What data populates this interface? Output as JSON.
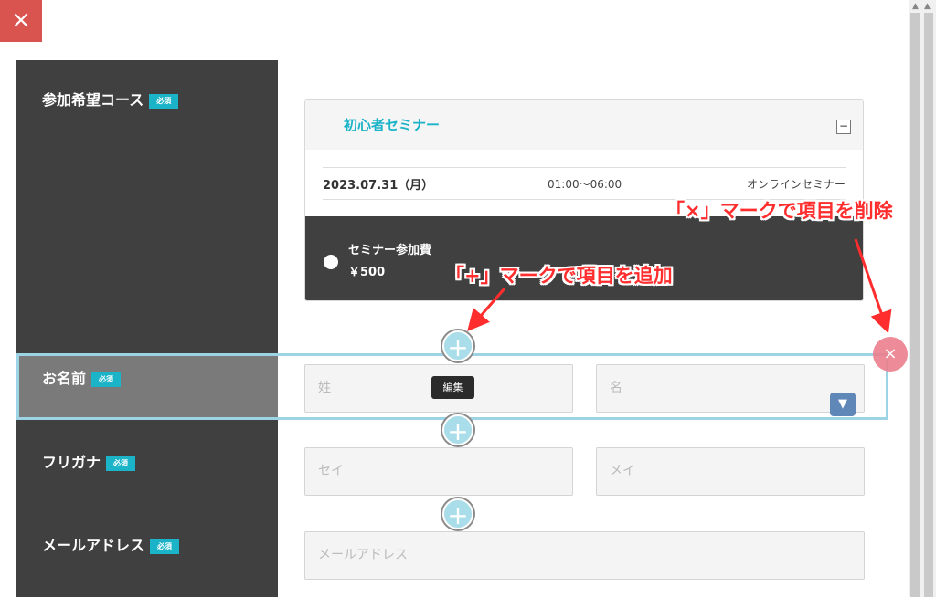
{
  "window": {
    "close_label": "×"
  },
  "form": {
    "fields": [
      {
        "label": "参加希望コース",
        "required": "必須"
      },
      {
        "label": "お名前",
        "required": "必須"
      },
      {
        "label": "フリガナ",
        "required": "必須"
      },
      {
        "label": "メールアドレス",
        "required": "必須"
      }
    ],
    "course": {
      "title": "初心者セミナー",
      "collapse_label": "−",
      "date": "2023.07.31（月）",
      "time": "01:00～06:00",
      "type": "オンラインセミナー",
      "fee_label": "セミナー参加費",
      "fee_price": "￥500"
    },
    "inputs": {
      "last_name_placeholder": "姓",
      "first_name_placeholder": "名",
      "last_kana_placeholder": "セイ",
      "first_kana_placeholder": "メイ",
      "email_placeholder": "メールアドレス"
    }
  },
  "editor": {
    "plus_label": "+",
    "delete_label": "×",
    "edit_tooltip": "編集",
    "dropdown_label": "▼"
  },
  "annotations": {
    "delete_note": "「×」マークで項目を削除",
    "add_note": "「+」マークで項目を追加",
    "color": "#ff2d2d"
  },
  "scrollbar": {
    "up": "▲",
    "down": "▼"
  },
  "colors": {
    "accent": "#1ab3c8",
    "panel": "#404040",
    "close": "#d9534f",
    "selection": "#9cd4e6",
    "delete": "#ec7f8d"
  }
}
